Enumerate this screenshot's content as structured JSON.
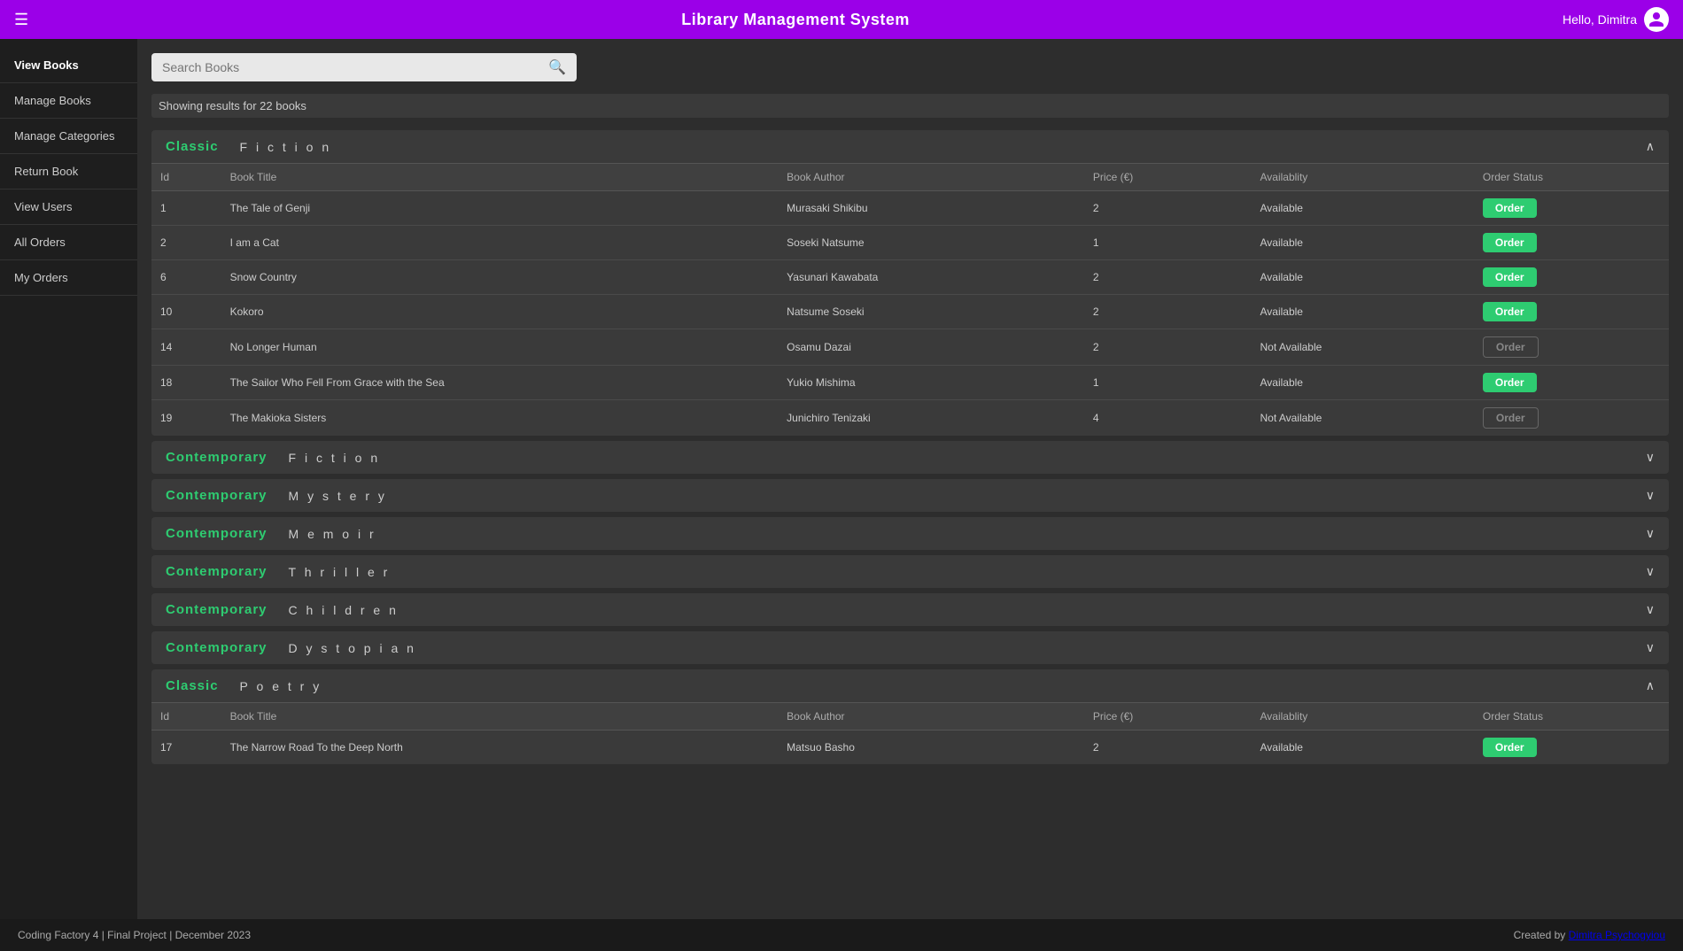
{
  "header": {
    "menu_icon": "☰",
    "title": "Library Management System",
    "user_greeting": "Hello, Dimitra"
  },
  "sidebar": {
    "items": [
      {
        "id": "view-books",
        "label": "View Books",
        "active": true
      },
      {
        "id": "manage-books",
        "label": "Manage Books",
        "active": false
      },
      {
        "id": "manage-categories",
        "label": "Manage Categories",
        "active": false
      },
      {
        "id": "return-book",
        "label": "Return Book",
        "active": false
      },
      {
        "id": "view-users",
        "label": "View Users",
        "active": false
      },
      {
        "id": "all-orders",
        "label": "All Orders",
        "active": false
      },
      {
        "id": "my-orders",
        "label": "My Orders",
        "active": false
      }
    ]
  },
  "search": {
    "placeholder": "Search Books",
    "value": ""
  },
  "results": {
    "text": "Showing results for 22 books"
  },
  "sections": [
    {
      "id": "classic-fiction",
      "type": "Classic",
      "genre": "Fiction",
      "expanded": true,
      "columns": [
        "Id",
        "Book Title",
        "Book Author",
        "Price (€)",
        "Availablity",
        "Order Status"
      ],
      "books": [
        {
          "id": 1,
          "title": "The Tale of Genji",
          "author": "Murasaki Shikibu",
          "price": 2,
          "availability": "Available",
          "order_enabled": true
        },
        {
          "id": 2,
          "title": "I am a Cat",
          "author": "Soseki Natsume",
          "price": 1,
          "availability": "Available",
          "order_enabled": true
        },
        {
          "id": 6,
          "title": "Snow Country",
          "author": "Yasunari Kawabata",
          "price": 2,
          "availability": "Available",
          "order_enabled": true
        },
        {
          "id": 10,
          "title": "Kokoro",
          "author": "Natsume Soseki",
          "price": 2,
          "availability": "Available",
          "order_enabled": true
        },
        {
          "id": 14,
          "title": "No Longer Human",
          "author": "Osamu Dazai",
          "price": 2,
          "availability": "Not Available",
          "order_enabled": false
        },
        {
          "id": 18,
          "title": "The Sailor Who Fell From Grace with the Sea",
          "author": "Yukio Mishima",
          "price": 1,
          "availability": "Available",
          "order_enabled": true
        },
        {
          "id": 19,
          "title": "The Makioka Sisters",
          "author": "Junichiro Tenizaki",
          "price": 4,
          "availability": "Not Available",
          "order_enabled": false
        }
      ]
    },
    {
      "id": "contemporary-fiction",
      "type": "Contemporary",
      "genre": "Fiction",
      "expanded": false,
      "books": []
    },
    {
      "id": "contemporary-mystery",
      "type": "Contemporary",
      "genre": "Mystery",
      "expanded": false,
      "books": []
    },
    {
      "id": "contemporary-memoir",
      "type": "Contemporary",
      "genre": "Memoir",
      "expanded": false,
      "books": []
    },
    {
      "id": "contemporary-thriller",
      "type": "Contemporary",
      "genre": "Thriller",
      "expanded": false,
      "books": []
    },
    {
      "id": "contemporary-children",
      "type": "Contemporary",
      "genre": "Children",
      "expanded": false,
      "books": []
    },
    {
      "id": "contemporary-dystopian",
      "type": "Contemporary",
      "genre": "Dystopian",
      "expanded": false,
      "books": []
    },
    {
      "id": "classic-poetry",
      "type": "Classic",
      "genre": "Poetry",
      "expanded": true,
      "columns": [
        "Id",
        "Book Title",
        "Book Author",
        "Price (€)",
        "Availablity",
        "Order Status"
      ],
      "books": [
        {
          "id": 17,
          "title": "The Narrow Road To the Deep North",
          "author": "Matsuo Basho",
          "price": 2,
          "availability": "Available",
          "order_enabled": true
        }
      ]
    }
  ],
  "footer": {
    "left": "Coding Factory 4 | Final Project | December 2023",
    "right_prefix": "Created by ",
    "right_author": "Dimitra Psychogyiou"
  },
  "order_btn_label": "Order"
}
